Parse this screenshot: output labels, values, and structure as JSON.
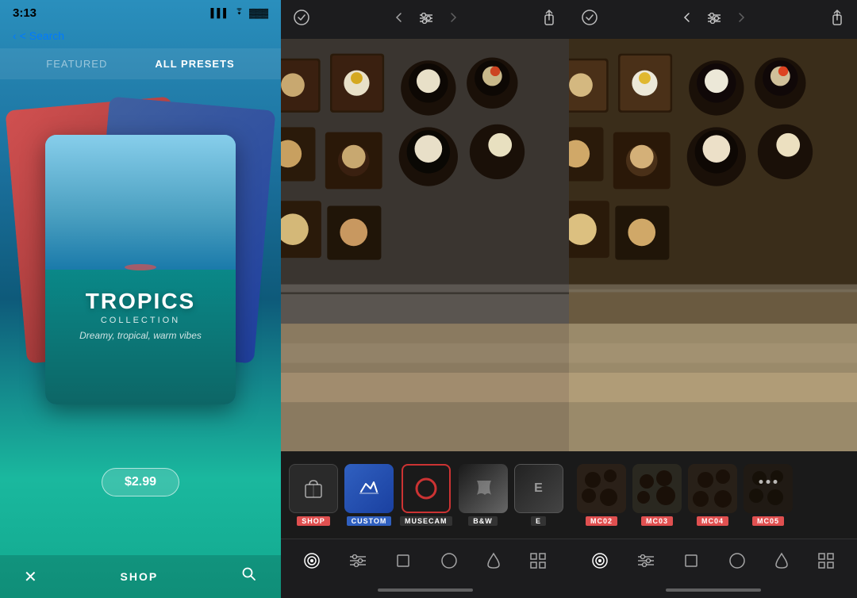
{
  "statusBar": {
    "time": "3:13",
    "signal": "▌▌▌",
    "wifi": "WiFi",
    "battery": "🔋"
  },
  "panel1": {
    "navBack": "< Search",
    "tabs": [
      {
        "label": "FEATURED",
        "active": false
      },
      {
        "label": "ALL PRESETS",
        "active": true
      }
    ],
    "presetCard": {
      "title": "TROPICS",
      "subtitle": "COLLECTION",
      "tagline": "Dreamy, tropical, warm vibes",
      "price": "$2.99"
    },
    "bottomBar": {
      "closeLabel": "✕",
      "shopLabel": "SHOP",
      "searchLabel": "🔍"
    }
  },
  "panel2": {
    "topbar": {
      "checkIcon": "✓",
      "backIcon": "←",
      "adjustIcon": "≡",
      "forwardIcon": "→",
      "shareIcon": "↑"
    },
    "presets": [
      {
        "label": "SHOP",
        "tag": "SHOP",
        "tagColor": "red",
        "type": "shop"
      },
      {
        "label": "CUSTOM",
        "tag": "CUSTOM",
        "tagColor": "blue",
        "type": "custom"
      },
      {
        "label": "MUSECAM",
        "tag": "MUSECAM",
        "tagColor": "dark",
        "type": "musecam"
      },
      {
        "label": "B&W",
        "tag": "B&W",
        "tagColor": "dark",
        "type": "bw"
      },
      {
        "label": "E",
        "tag": "E",
        "tagColor": "dark",
        "type": "other"
      }
    ],
    "tools": [
      "filter",
      "adjust",
      "crop",
      "circle",
      "drop",
      "grid"
    ]
  },
  "panel3": {
    "topbar": {
      "checkIcon": "✓",
      "backIcon": "←",
      "adjustIcon": "≡",
      "forwardIcon": "→",
      "shareIcon": "↑"
    },
    "presets": [
      {
        "label": "MC02",
        "tag": "MC02",
        "tagColor": "red",
        "type": "mc02"
      },
      {
        "label": "MC03",
        "tag": "MC03",
        "tagColor": "red",
        "type": "mc03"
      },
      {
        "label": "MC04",
        "tag": "MC04",
        "tagColor": "red",
        "type": "mc04"
      },
      {
        "label": "MC05",
        "tag": "MC05",
        "tagColor": "red",
        "type": "mc05"
      }
    ],
    "tools": [
      "filter",
      "adjust",
      "crop",
      "circle",
      "drop",
      "grid"
    ]
  }
}
